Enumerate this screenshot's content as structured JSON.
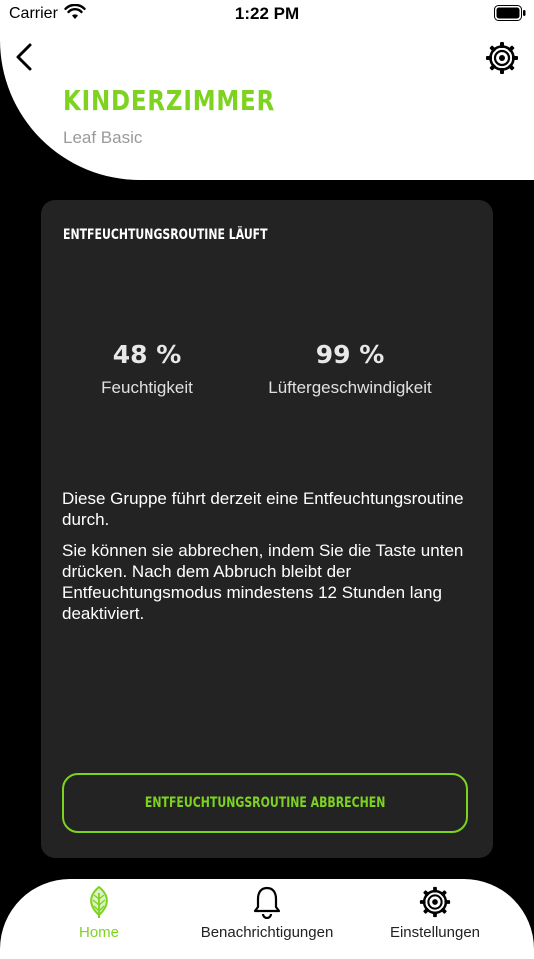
{
  "status_bar": {
    "carrier": "Carrier",
    "time": "1:22 PM"
  },
  "header": {
    "title": "KINDERZIMMER",
    "subtitle": "Leaf Basic",
    "back_icon": "chevron-left-icon",
    "settings_icon": "gear-icon"
  },
  "card": {
    "heading": "ENTFEUCHTUNGSROUTINE LÄUFT",
    "stats": [
      {
        "value": "48 %",
        "label": "Feuchtigkeit"
      },
      {
        "value": "99 %",
        "label": "Lüftergeschwindigkeit"
      }
    ],
    "paragraphs": [
      "Diese Gruppe führt derzeit eine Entfeuchtungsroutine durch.",
      "Sie können sie abbrechen, indem Sie die Taste unten drücken. Nach dem Abbruch bleibt der Entfeuchtungsmodus mindestens 12 Stunden lang deaktiviert."
    ],
    "cancel_label": "ENTFEUCHTUNGSROUTINE ABBRECHEN"
  },
  "tabbar": {
    "tabs": [
      {
        "label": "Home",
        "icon": "leaf-icon",
        "active": true
      },
      {
        "label": "Benachrichtigungen",
        "icon": "bell-icon",
        "active": false
      },
      {
        "label": "Einstellungen",
        "icon": "gear-icon",
        "active": false
      }
    ]
  },
  "colors": {
    "accent": "#7ed321",
    "background": "#000000",
    "card": "#232323",
    "header": "#ffffff"
  }
}
